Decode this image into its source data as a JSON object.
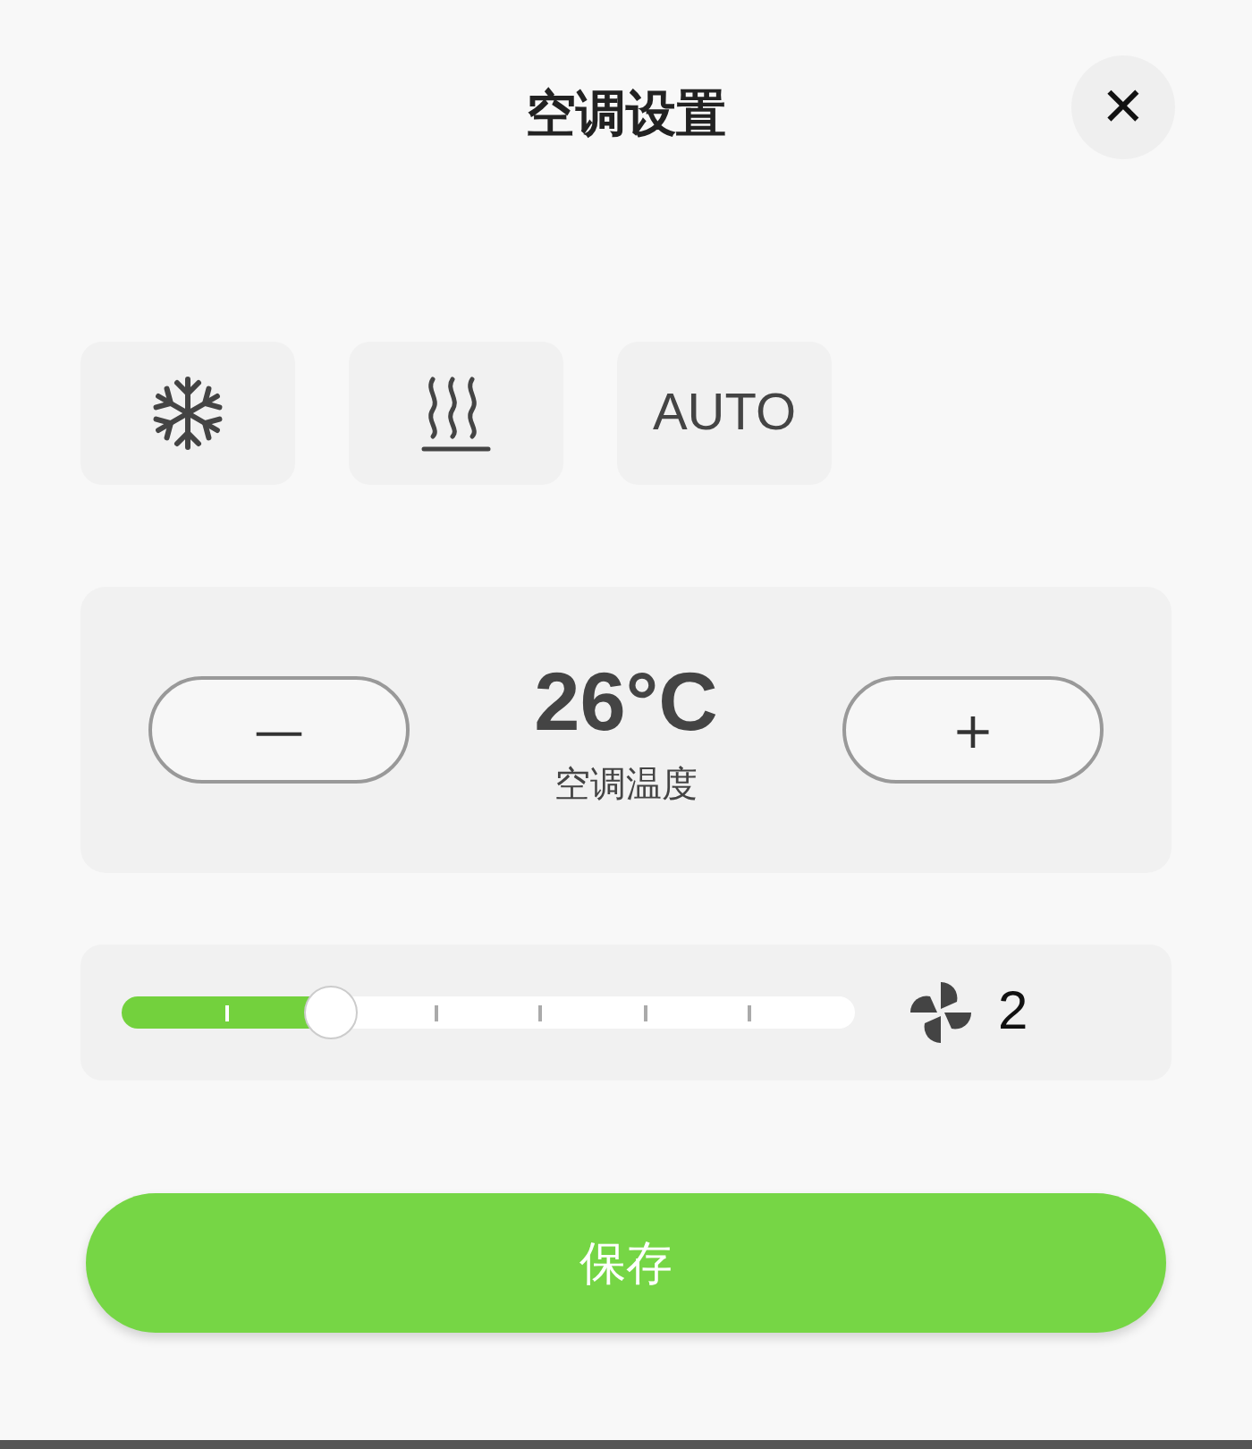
{
  "title": "空调设置",
  "close_button": {
    "label": "✕"
  },
  "modes": [
    {
      "kind": "cool",
      "selected": false
    },
    {
      "kind": "heat",
      "selected": false
    },
    {
      "kind": "auto",
      "label": "AUTO",
      "selected": false
    }
  ],
  "temperature": {
    "decrease": "—",
    "value": "26°C",
    "label": "空调温度",
    "increase": "+"
  },
  "fan": {
    "level": 0.2857,
    "reading": "2"
  },
  "save_button": "保存"
}
